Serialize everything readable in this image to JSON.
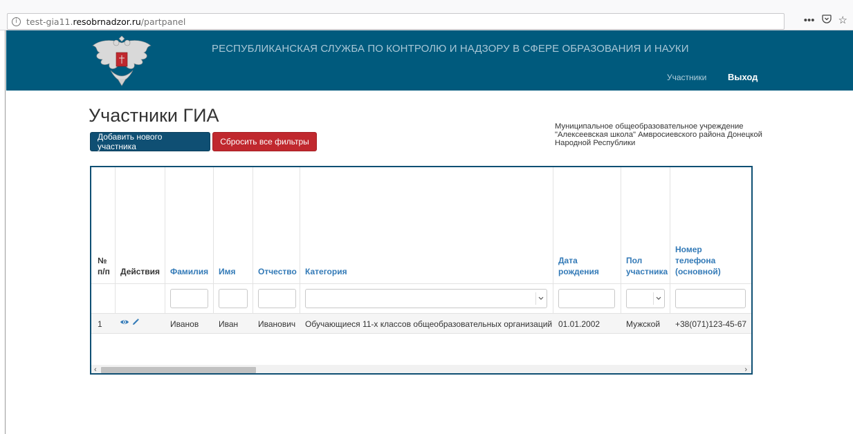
{
  "browser": {
    "url_prefix": "test-gia11.",
    "url_host": "resobrnadzor.ru",
    "url_path": "/partpanel",
    "actions": [
      "•••",
      "⊙",
      "☆"
    ]
  },
  "header": {
    "org_title": "РЕСПУБЛИКАНСКАЯ СЛУЖБА ПО КОНТРОЛЮ И НАДЗОРУ В СФЕРЕ ОБРАЗОВАНИЯ И НАУКИ",
    "nav_participants": "Участники",
    "nav_exit": "Выход",
    "bg_color": "#005a7d"
  },
  "page": {
    "title": "Участники ГИА",
    "add_button": "Добавить нового участника",
    "reset_button": "Сбросить все фильтры",
    "school_name": "Муниципальное общеобразовательное учреждение \"Алексеевская школа\" Амвросиевского района Донецкой Народной Республики"
  },
  "table": {
    "headers": {
      "num_line1": "№",
      "num_line2": "п/п",
      "actions": "Действия",
      "surname": "Фамилия",
      "name": "Имя",
      "patronymic": "Отчество",
      "category": "Категория",
      "birth_line1": "Дата",
      "birth_line2": "рождения",
      "gender_line1": "Пол",
      "gender_line2": "участника",
      "phone_line1": "Номер",
      "phone_line2": "телефона",
      "phone_line3": "(основной)"
    },
    "rows": [
      {
        "num": "1",
        "surname": "Иванов",
        "name": "Иван",
        "patronymic": "Иванович",
        "category": "Обучающиеся 11-х классов общеобразовательных организаций",
        "birth_date": "01.01.2002",
        "gender": "Мужской",
        "phone": "+38(071)123-45-67"
      }
    ]
  }
}
